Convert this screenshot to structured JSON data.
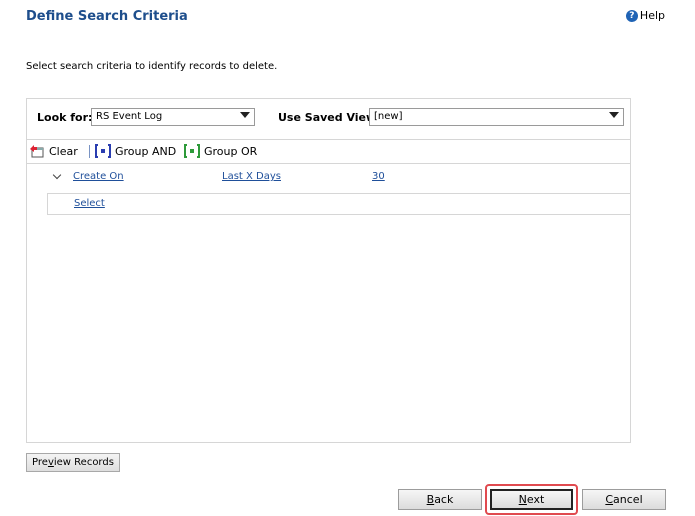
{
  "header": {
    "title": "Define Search Criteria",
    "help_label": "Help"
  },
  "instruction": "Select search criteria to identify records to delete.",
  "criteria_bar": {
    "look_for_label": "Look for:",
    "look_for_value": "RS Event Log",
    "saved_view_label": "Use Saved View:",
    "saved_view_value": "[new]"
  },
  "toolbar": {
    "clear_label": "Clear",
    "group_and_label": "Group AND",
    "group_or_label": "Group OR"
  },
  "condition": {
    "field": "Create On",
    "operator": "Last X Days",
    "value": "30"
  },
  "select_link": "Select",
  "buttons": {
    "preview_pre": "Pre",
    "preview_key": "v",
    "preview_post": "iew Records",
    "back_key": "B",
    "back_rest": "ack",
    "next_key": "N",
    "next_rest": "ext",
    "cancel_key": "C",
    "cancel_rest": "ancel"
  },
  "colors": {
    "title": "#1e4e8c",
    "link": "#1f4f9a",
    "highlight": "#e04a4f"
  }
}
